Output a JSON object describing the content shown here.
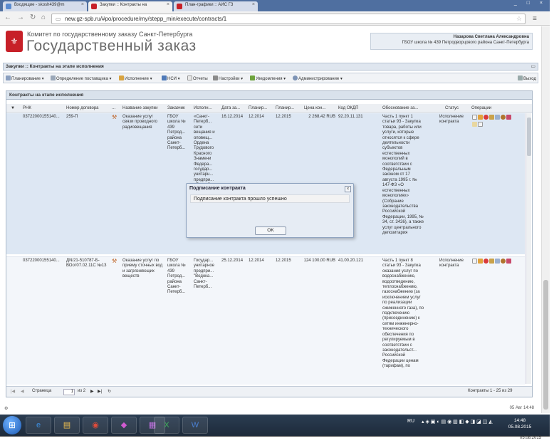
{
  "browser": {
    "tabs": [
      {
        "label": "Входящие - skosh439@m"
      },
      {
        "label": "Закупки :: Контракты на"
      },
      {
        "label": "План-графики :: АИС ГЗ"
      }
    ],
    "url": "new.gz-spb.ru/#po/procedure/my/stepp_min/execute/contracts/1"
  },
  "header": {
    "subtitle": "Комитет по государственному заказу Санкт-Петербурга",
    "title": "Государственный заказ",
    "user_name": "Назарова Светлана Александровна",
    "user_org": "ГБОУ школа № 439 Петродворцового района Санкт-Петербурга"
  },
  "app": {
    "title": "Закупки :: Контракты на этапе исполнения",
    "toolbar": {
      "planning": "Планирование",
      "supplier": "Определение поставщика",
      "execution": "Исполнение",
      "nsi": "НСИ",
      "reports": "Отчеты",
      "settings": "Настройки",
      "notifications": "Уведомления",
      "admin": "Администрирование",
      "exit": "Выход"
    }
  },
  "grid": {
    "title": "Контракты на этапе исполнения",
    "columns": [
      "РНК",
      "Номер договора",
      "...",
      "Название закупки",
      "Заказчик",
      "Исполн...",
      "Дата за...",
      "Планир...",
      "Планир...",
      "Цена кон...",
      "Код ОКДП",
      "Обоснование за...",
      "Статус",
      "Операции"
    ],
    "rows": [
      {
        "rnk": "03722000155140...",
        "number": "259-П",
        "name": "Оказание услуг связи проводного радиовещания",
        "customer": "ГБОУ школа № 439 Петрод... района Санкт-Петерб...",
        "executor": "«Санкт-Петерб... сети вещания и оповещ... Ордена Трудового Красного Знамени Федера... государ... унитарн... предпри... «Россий... сети вещания и",
        "date": "16.12.2014",
        "plan1": "12.2014",
        "plan2": "12.2015",
        "price": "2 268,42 RUB",
        "okdp": "92.20.11.131",
        "basis": "Часть 1 пункт 1 статьи 93 - Закупка товара, работы или услуги, которые относятся к сфере деятельности субъектов естественных монополий в соответствии с Федеральным законом от 17 августа 1995 г. № 147-ФЗ «О естественных монополиях» (Собрание законодательства Российской Федерации, 1995, № 34, ст. 3426), а также услуг центрального депозитария",
        "status": "Исполнение контракта"
      },
      {
        "rnk": "03722000155140...",
        "number": "ДN/21-510787-Б-ВОот07.02.11С №13",
        "name": "Оказание услуг по приему сточных вод и загрязняющих веществ",
        "customer": "ГБОУ школа № 439 Петрод... района Санкт-Петерб...",
        "executor": "Государ... унитарное предпри... \"Водока... Санкт-Петерб...",
        "date": "25.12.2014",
        "plan1": "12.2014",
        "plan2": "12.2015",
        "price": "124 100,00 RUB",
        "okdp": "41.00.20.121",
        "basis": "Часть 1 пункт 8 статьи 93 - Закупка оказания услуг по водоснабжению, водоотведению, теплоснабжению, газоснабжению (за исключением услуг по реализации сжиженного газа), по подключению (присоединению) к сетям инженерно-технического обеспечения по регулируемым в соответствии с законодательст... Российской Федерации ценам (тарифам), по",
        "status": "Исполнение контракта"
      }
    ],
    "pager": {
      "page_label": "Страница",
      "page_value": "1",
      "of_label": "из 2",
      "summary": "Контракты 1 - 25 из 29"
    }
  },
  "status_bar": {
    "date": "05 Авг 14:48"
  },
  "dialog": {
    "title": "Подписание контракта",
    "message": "Подписание контракта прошло успешно",
    "ok": "OK"
  },
  "taskbar": {
    "lang": "RU",
    "time": "14:48",
    "date": "05.08.2015"
  }
}
